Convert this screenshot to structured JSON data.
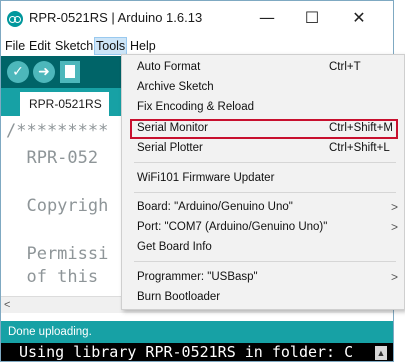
{
  "window": {
    "title": "RPR-0521RS | Arduino 1.6.13",
    "minimize_glyph": "—",
    "maximize_glyph": "☐",
    "close_glyph": "✕"
  },
  "menubar": {
    "items": [
      {
        "label": "File"
      },
      {
        "label": "Edit"
      },
      {
        "label": "Sketch"
      },
      {
        "label": "Tools",
        "active": true
      },
      {
        "label": "Help"
      }
    ]
  },
  "toolbar": {
    "verify_glyph": "✓",
    "upload_glyph": "➜"
  },
  "tabs": {
    "active_tab": "RPR-0521RS"
  },
  "editor": {
    "lines": [
      "/*********",
      "  RPR-052",
      "",
      "  Copyrigh",
      "",
      "  Permissi",
      "  of this"
    ]
  },
  "hscroll": {
    "left_arrow": "<"
  },
  "status": {
    "text": "Done uploading."
  },
  "console": {
    "text": "Using library RPR-0521RS in folder: C",
    "scroll_glyph": "▲"
  },
  "tools_menu": {
    "items": [
      {
        "label": "Auto Format",
        "shortcut": "Ctrl+T"
      },
      {
        "label": "Archive Sketch",
        "shortcut": ""
      },
      {
        "label": "Fix Encoding & Reload",
        "shortcut": ""
      },
      {
        "label": "Serial Monitor",
        "shortcut": "Ctrl+Shift+M"
      },
      {
        "label": "Serial Plotter",
        "shortcut": "Ctrl+Shift+L"
      },
      {
        "label": "WiFi101 Firmware Updater",
        "shortcut": ""
      },
      {
        "label": "Board: \"Arduino/Genuino Uno\"",
        "shortcut": "",
        "arrow": ">"
      },
      {
        "label": "Port: \"COM7 (Arduino/Genuino Uno)\"",
        "shortcut": "",
        "arrow": ">"
      },
      {
        "label": "Get Board Info",
        "shortcut": ""
      },
      {
        "label": "Programmer: \"USBasp\"",
        "shortcut": "",
        "arrow": ">"
      },
      {
        "label": "Burn Bootloader",
        "shortcut": ""
      }
    ]
  },
  "colors": {
    "toolbar_bg": "#006468",
    "tab_strip_bg": "#17a1a5",
    "highlight_border": "#c8102e",
    "menu_active_bg": "#cce4f7"
  }
}
